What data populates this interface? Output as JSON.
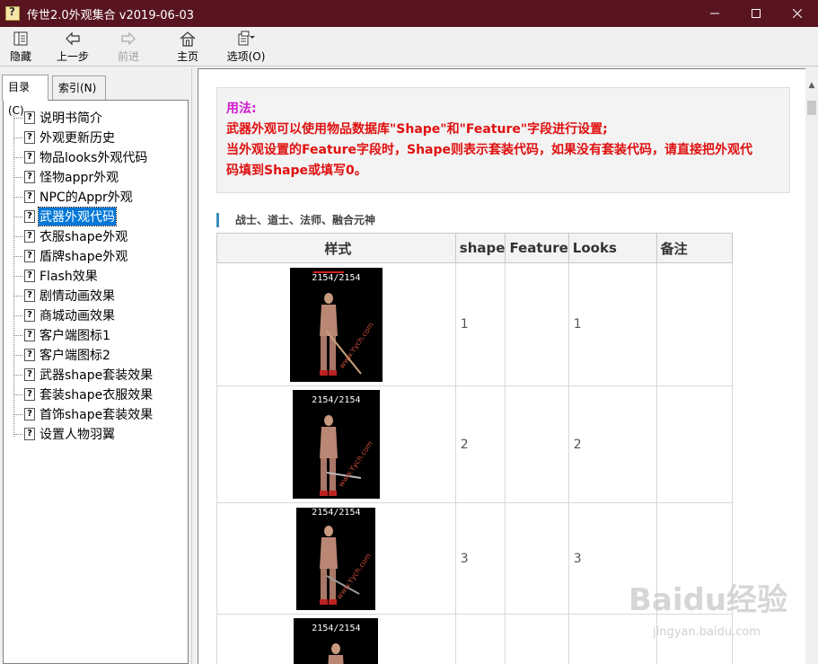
{
  "window": {
    "title": "传世2.0外观集合 v2019-06-03"
  },
  "toolbar": {
    "hide_label": "隐藏",
    "back_label": "上一步",
    "forward_label": "前进",
    "home_label": "主页",
    "options_label": "选项(O)"
  },
  "tabs": {
    "toc_label": "目录(C)",
    "index_label": "索引(N)"
  },
  "tree": {
    "items": [
      "说明书简介",
      "外观更新历史",
      "物品looks外观代码",
      "怪物appr外观",
      "NPC的Appr外观",
      "武器外观代码",
      "衣服shape外观",
      "盾牌shape外观",
      "Flash效果",
      "剧情动画效果",
      "商城动画效果",
      "客户端图标1",
      "客户端图标2",
      "武器shape套装效果",
      "套装shape衣服效果",
      "首饰shape套装效果",
      "设置人物羽翼"
    ],
    "selected_index": 5
  },
  "note": {
    "title": "用法:",
    "line1": "武器外观可以使用物品数据库\"Shape\"和\"Feature\"字段进行设置;",
    "line2": "当外观设置的Feature字段时，Shape则表示套装代码，如果没有套装代码，请直接把外观代",
    "line3": "码填到Shape或填写0。"
  },
  "section": {
    "title": "战士、道士、法师、融合元神"
  },
  "table": {
    "headers": [
      "样式",
      "shape",
      "Feature",
      "Looks",
      "备注"
    ],
    "rows": [
      {
        "hp": "2154/2154",
        "shape": "1",
        "feature": "",
        "looks": "1",
        "note": ""
      },
      {
        "hp": "2154/2154",
        "shape": "2",
        "feature": "",
        "looks": "2",
        "note": ""
      },
      {
        "hp": "2154/2154",
        "shape": "3",
        "feature": "",
        "looks": "3",
        "note": ""
      },
      {
        "hp": "2154/2154",
        "shape": "",
        "feature": "",
        "looks": "",
        "note": ""
      }
    ],
    "sprite_watermark": "www.Yych.com"
  },
  "watermark": {
    "main": "Baidu经验",
    "sub": "jingyan.baidu.com"
  },
  "colors": {
    "titlebar": "#581520",
    "selected": "#0078d7",
    "note_title": "#d11ad1",
    "note_text": "#e01010"
  }
}
